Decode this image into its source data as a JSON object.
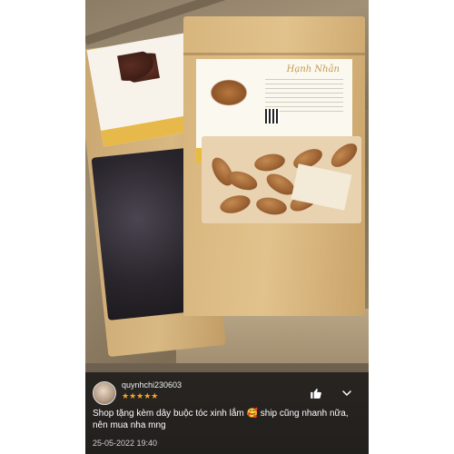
{
  "review": {
    "username": "quynhchi230603",
    "rating_stars": "★★★★★",
    "rating": 5,
    "comment": "Shop tặng kèm dây buộc tóc xinh lắm 🥰 ship cũng nhanh nữa, nên mua nha mng",
    "date": "25-05-2022 19:40"
  },
  "product_label": {
    "title": "Hạnh Nhân"
  },
  "icons": {
    "like": "thumbs-up-icon",
    "expand": "chevron-down-icon",
    "avatar": "avatar"
  },
  "colors": {
    "star": "#f5a623",
    "overlay": "#141414"
  }
}
